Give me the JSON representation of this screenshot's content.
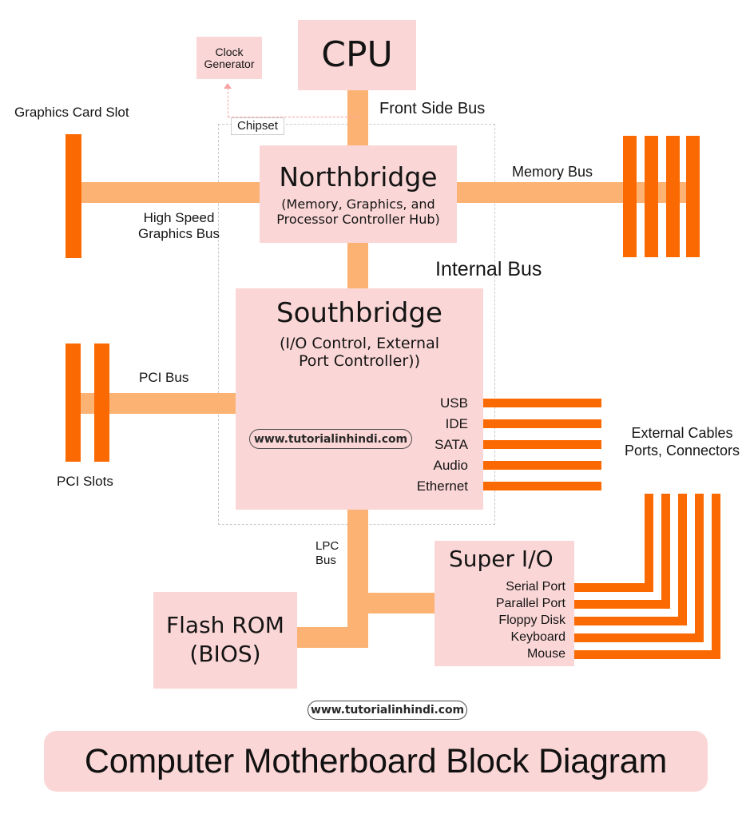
{
  "diagram": {
    "title": "Computer Motherboard Block Diagram",
    "watermark": "www.tutorialinhindi.com",
    "chipset_tag": "Chipset",
    "colors": {
      "block_fill": "#fbd6d6",
      "bus_light": "#fcb273",
      "bus_orange": "#fb6a02",
      "banner_fill": "#fbd6d6",
      "dashed_border": "#c9c9c9",
      "clock_dashed": "#f5a3a3",
      "text": "#141414"
    }
  },
  "blocks": {
    "cpu": {
      "title": "CPU",
      "sub": ""
    },
    "clock_generator": {
      "title": "Clock\nGenerator",
      "sub": ""
    },
    "northbridge": {
      "title": "Northbridge",
      "sub": "(Memory, Graphics, and\nProcessor Controller Hub)"
    },
    "southbridge": {
      "title": "Southbridge",
      "sub": "(I/O Control, External\nPort Controller))"
    },
    "super_io": {
      "title": "Super I/O",
      "sub": ""
    },
    "flash_rom": {
      "title": "Flash ROM",
      "sub": "(BIOS)"
    }
  },
  "bus_labels": {
    "front_side_bus": "Front Side Bus",
    "memory_bus": "Memory Bus",
    "high_speed_graphics_bus": "High Speed\nGraphics Bus",
    "internal_bus": "Internal Bus",
    "pci_bus": "PCI Bus",
    "lpc_bus": "LPC\nBus"
  },
  "component_labels": {
    "graphics_card_slot": "Graphics Card Slot",
    "pci_slots": "PCI Slots",
    "external_cables": "External Cables\nPorts, Connectors"
  },
  "southbridge_ports": [
    {
      "label": "USB"
    },
    {
      "label": "IDE"
    },
    {
      "label": "SATA"
    },
    {
      "label": "Audio"
    },
    {
      "label": "Ethernet"
    }
  ],
  "super_io_ports": [
    {
      "label": "Serial Port"
    },
    {
      "label": "Parallel Port"
    },
    {
      "label": "Floppy Disk"
    },
    {
      "label": "Keyboard"
    },
    {
      "label": "Mouse"
    }
  ],
  "memory_slots": {
    "count": 4
  },
  "pci_slot_items": {
    "count": 2
  }
}
